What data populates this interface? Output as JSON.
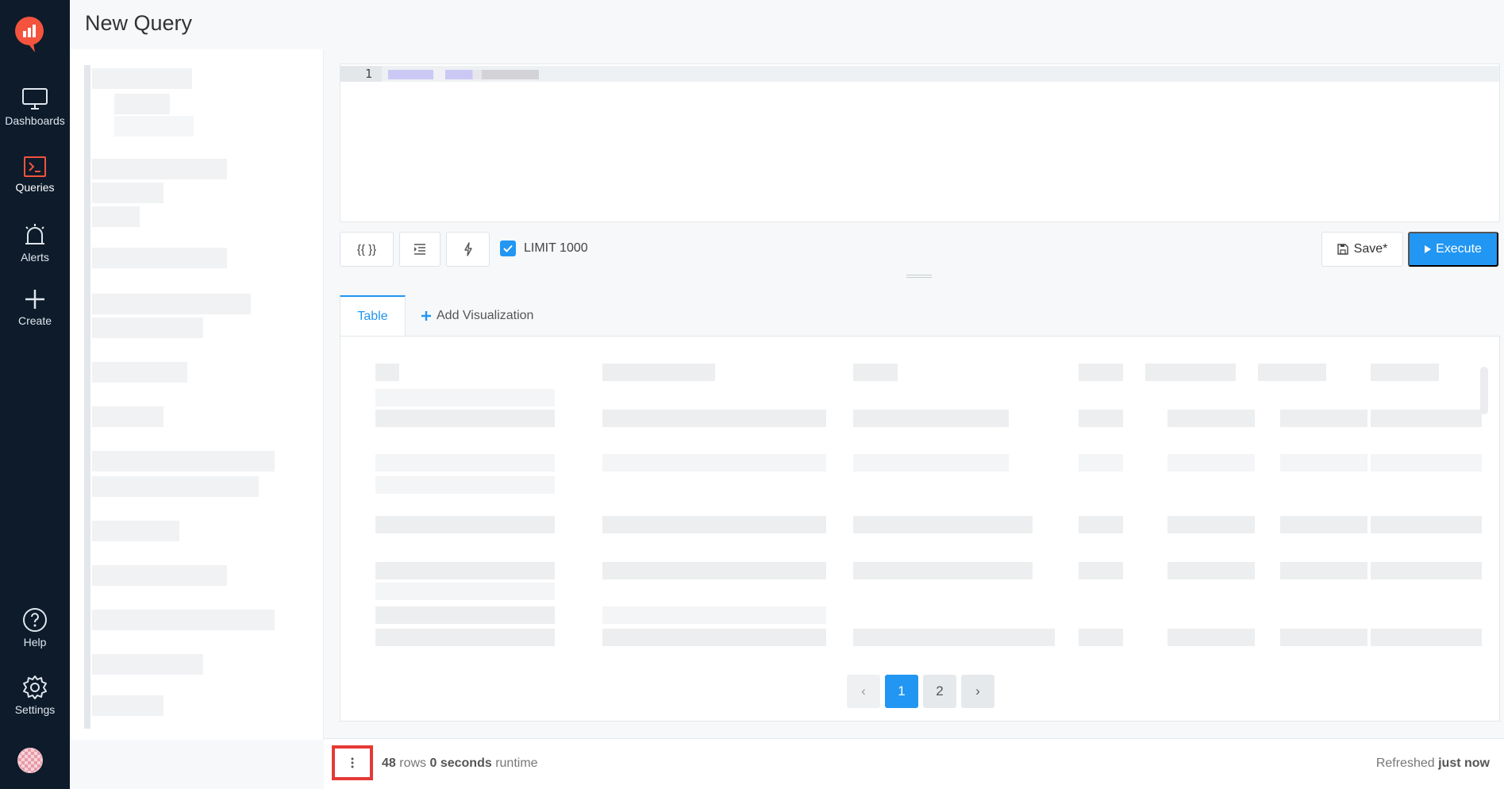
{
  "header": {
    "title": "New Query"
  },
  "sidebar": {
    "items": [
      {
        "label": "Dashboards",
        "icon": "monitor-icon"
      },
      {
        "label": "Queries",
        "icon": "terminal-icon"
      },
      {
        "label": "Alerts",
        "icon": "bell-icon"
      },
      {
        "label": "Create",
        "icon": "plus-icon"
      },
      {
        "label": "Help",
        "icon": "help-icon"
      },
      {
        "label": "Settings",
        "icon": "gear-icon"
      }
    ],
    "active": "Queries",
    "accent": "#f4533e"
  },
  "editor": {
    "line_numbers": [
      "1"
    ]
  },
  "toolbar": {
    "param_button": "{{ }}",
    "limit_checked": true,
    "limit_label": "LIMIT 1000",
    "save_label": "Save*",
    "execute_label": "Execute"
  },
  "results": {
    "tabs": [
      {
        "label": "Table",
        "active": true
      },
      {
        "label": "Add Visualization"
      }
    ],
    "pagination": {
      "pages": [
        "1",
        "2"
      ],
      "current": "1"
    }
  },
  "footer": {
    "row_count": "48",
    "rows_label": "rows",
    "runtime": "0 seconds",
    "runtime_label": "runtime",
    "refreshed_prefix": "Refreshed",
    "refreshed_value": "just now"
  },
  "colors": {
    "primary": "#2196f3",
    "sidebar_bg": "#0d1b2a",
    "highlight": "#e53935"
  }
}
